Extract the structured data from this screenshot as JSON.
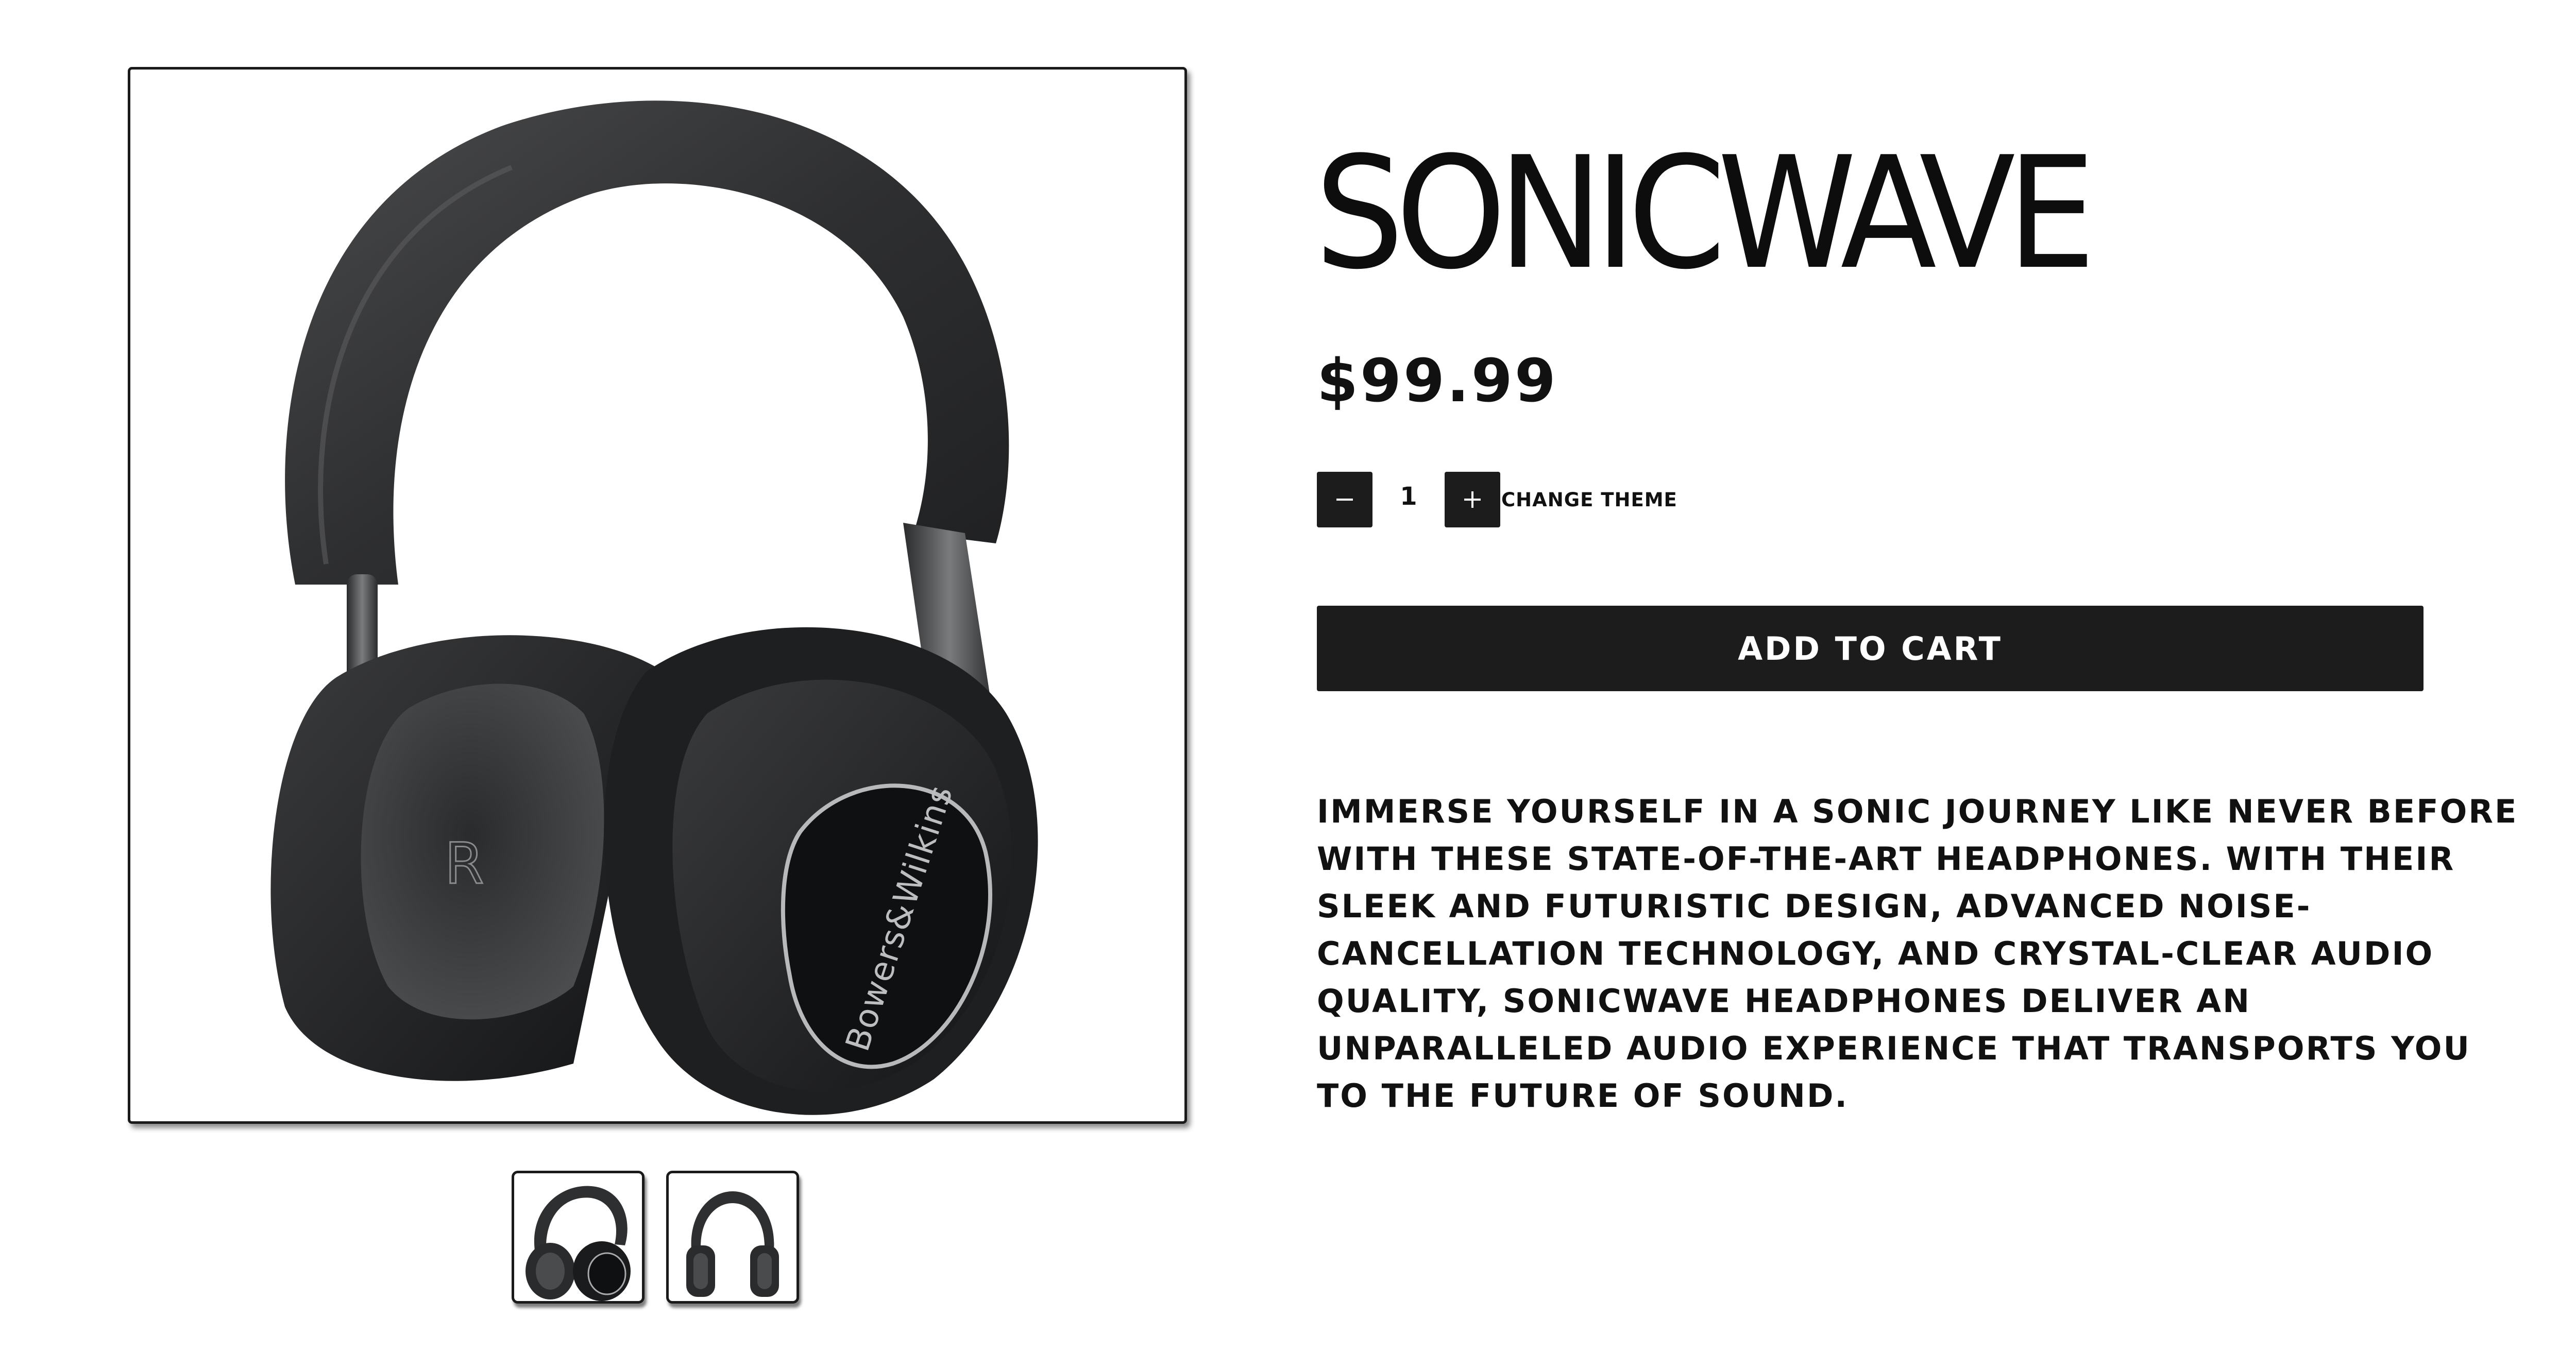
{
  "product": {
    "title": "SONICWAVE",
    "price": "$99.99",
    "quantity": "1",
    "image_alt": "Black over-ear headphones",
    "thumbnails": [
      "thumbnail-angle-view",
      "thumbnail-front-view"
    ],
    "brand_mark": "Bowers&Wilkins",
    "cup_letter": "R"
  },
  "controls": {
    "decrement_icon": "minus-icon",
    "increment_icon": "plus-icon",
    "change_theme_label": "CHANGE THEME",
    "add_to_cart_label": "ADD TO CART"
  },
  "description": "IMMERSE YOURSELF IN A SONIC JOURNEY LIKE NEVER BEFORE WITH THESE STATE-OF-THE-ART HEADPHONES. WITH THEIR SLEEK AND FUTURISTIC DESIGN, ADVANCED NOISE-CANCELLATION TECHNOLOGY, AND CRYSTAL-CLEAR AUDIO QUALITY, SONICWAVE HEADPHONES DELIVER AN UNPARALLELED AUDIO EXPERIENCE THAT TRANSPORTS YOU TO THE FUTURE OF SOUND.",
  "colors": {
    "button_bg": "#1c1c1c",
    "text": "#111111",
    "background": "#ffffff",
    "headphone_dark": "#2a2b2c"
  }
}
